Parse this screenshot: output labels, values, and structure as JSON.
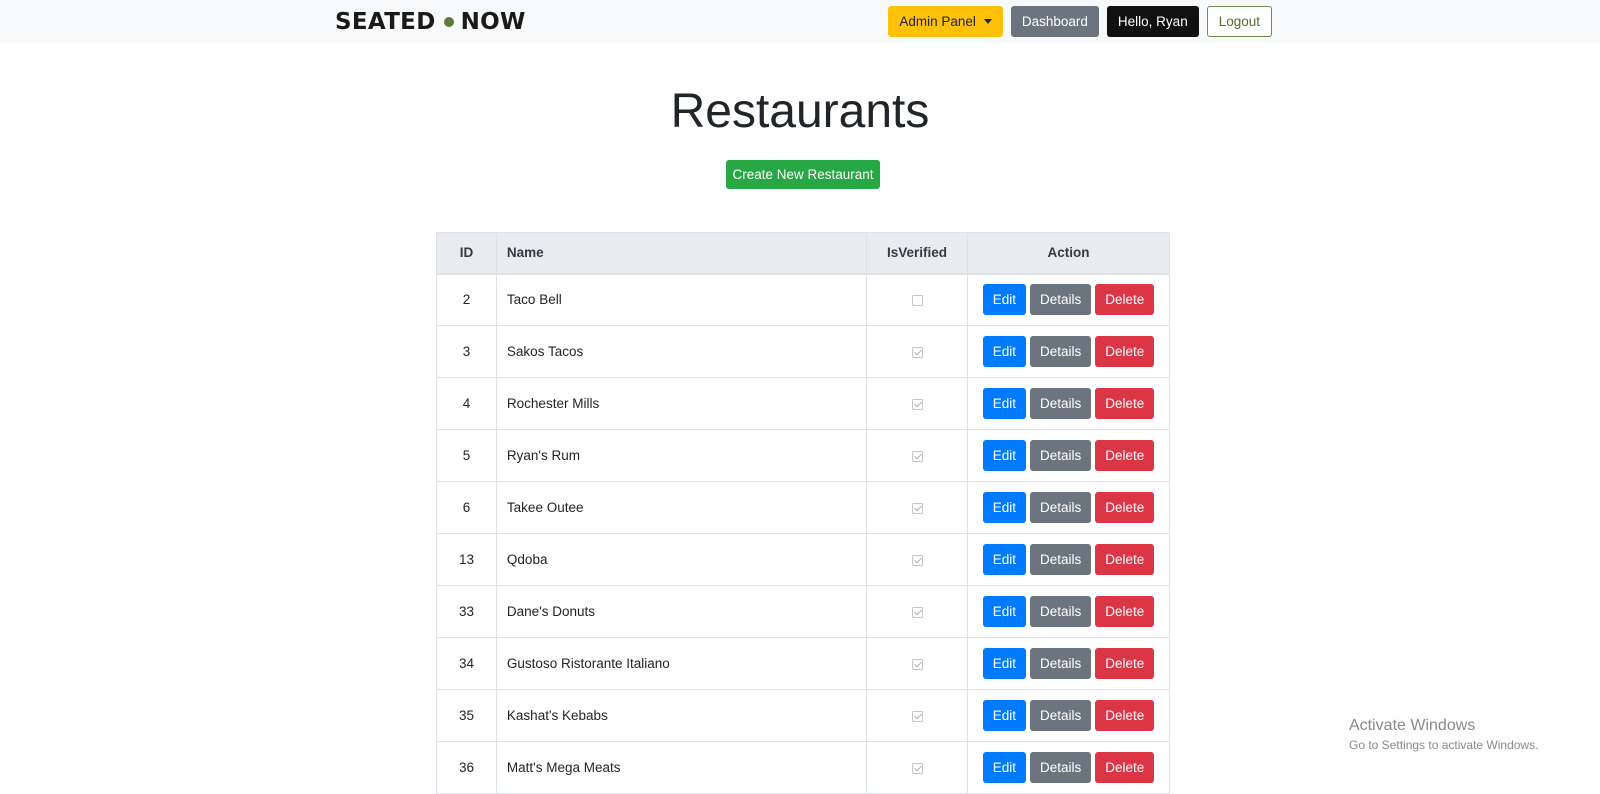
{
  "colors": {
    "navbar_bg": "#f8f9fa",
    "brand_dot": "#5c7a3e",
    "admin_btn": "#ffc107",
    "secondary": "#6c757d",
    "hello_btn": "#111111",
    "logout_border": "#6b8e4e",
    "logout_text": "#556b2f",
    "success": "#28a745",
    "primary": "#007bff",
    "danger": "#dc3545"
  },
  "navbar": {
    "brand_left": "SEATED",
    "brand_right": "NOW",
    "admin_panel_label": "Admin Panel",
    "dashboard_label": "Dashboard",
    "hello_label": "Hello, Ryan",
    "logout_label": "Logout"
  },
  "page": {
    "title": "Restaurants",
    "create_label": "Create New Restaurant"
  },
  "table": {
    "headers": {
      "id": "ID",
      "name": "Name",
      "verified": "IsVerified",
      "action": "Action"
    },
    "action_labels": {
      "edit": "Edit",
      "details": "Details",
      "delete": "Delete"
    },
    "rows": [
      {
        "id": "2",
        "name": "Taco Bell",
        "verified": false
      },
      {
        "id": "3",
        "name": "Sakos Tacos",
        "verified": true
      },
      {
        "id": "4",
        "name": "Rochester Mills",
        "verified": true
      },
      {
        "id": "5",
        "name": "Ryan's Rum",
        "verified": true
      },
      {
        "id": "6",
        "name": "Takee Outee",
        "verified": true
      },
      {
        "id": "13",
        "name": "Qdoba",
        "verified": true
      },
      {
        "id": "33",
        "name": "Dane's Donuts",
        "verified": true
      },
      {
        "id": "34",
        "name": "Gustoso Ristorante Italiano",
        "verified": true
      },
      {
        "id": "35",
        "name": "Kashat's Kebabs",
        "verified": true
      },
      {
        "id": "36",
        "name": "Matt's Mega Meats",
        "verified": true
      }
    ]
  },
  "watermark": {
    "line1": "Activate Windows",
    "line2": "Go to Settings to activate Windows."
  }
}
